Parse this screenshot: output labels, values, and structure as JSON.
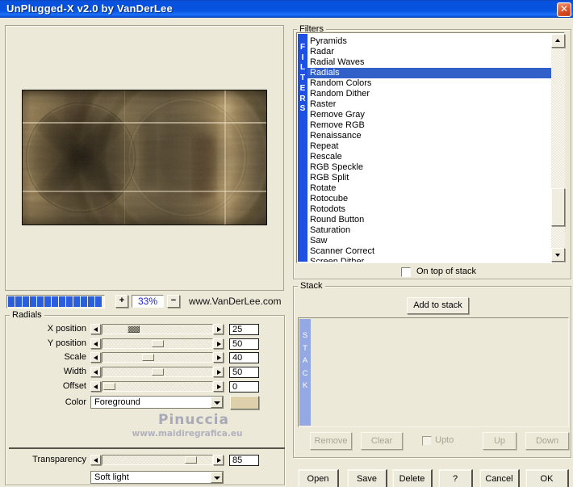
{
  "window": {
    "title": "UnPlugged-X v2.0 by VanDerLee"
  },
  "zoom": {
    "plus_label": "+",
    "level": "33%",
    "minus_label": "−"
  },
  "progress": {
    "segments": 13
  },
  "branding": {
    "vendor_url": "www.VanDerLee.com",
    "watermark_name": "Pinuccia",
    "watermark_url": "www.maidiregrafica.eu"
  },
  "filters": {
    "group_label": "Filters",
    "strip_label": "FILTERS",
    "items": [
      "Pyramids",
      "Radar",
      "Radial Waves",
      "Radials",
      "Random Colors",
      "Random Dither",
      "Raster",
      "Remove Gray",
      "Remove RGB",
      "Renaissance",
      "Repeat",
      "Rescale",
      "RGB Speckle",
      "RGB Split",
      "Rotate",
      "Rotocube",
      "Rotodots",
      "Round Button",
      "Saturation",
      "Saw",
      "Scanner Correct",
      "Screen Dither"
    ],
    "selected_item": "Radials",
    "on_top_checkbox": {
      "label": "On top of stack",
      "checked": false
    }
  },
  "radials": {
    "group_label": "Radials",
    "sliders": [
      {
        "label": "X position",
        "value": 25,
        "active": true
      },
      {
        "label": "Y position",
        "value": 50,
        "active": false
      },
      {
        "label": "Scale",
        "value": 40,
        "active": false
      },
      {
        "label": "Width",
        "value": 50,
        "active": false
      },
      {
        "label": "Offset",
        "value": 0,
        "active": false
      }
    ],
    "color_row": {
      "label": "Color",
      "value": "Foreground",
      "swatch_color": "#ddd0ab"
    }
  },
  "transparency": {
    "slider": {
      "label": "Transparency",
      "value": 85,
      "active": false
    },
    "blend_mode": "Soft light"
  },
  "stack": {
    "group_label": "Stack",
    "strip_label": "STACK",
    "add_button_label": "Add to stack",
    "remove_label": "Remove",
    "clear_label": "Clear",
    "up_label": "Up",
    "down_label": "Down",
    "upto_checkbox": {
      "label": "Upto",
      "checked": false,
      "enabled": false
    }
  },
  "dialog_buttons": [
    "Open",
    "Save",
    "Delete",
    "?",
    "Cancel",
    "OK"
  ],
  "colors": {
    "dialog_bg": "#ece9d8",
    "titlebar_blue": "#0852e0",
    "progress_blue": "#2b5ede",
    "filters_strip_blue": "#1e50e2",
    "selection_blue": "#3160c8",
    "stack_strip_blue": "#94a9e4",
    "close_red": "#d84c26",
    "zoom_text_blue": "#2222cc"
  }
}
